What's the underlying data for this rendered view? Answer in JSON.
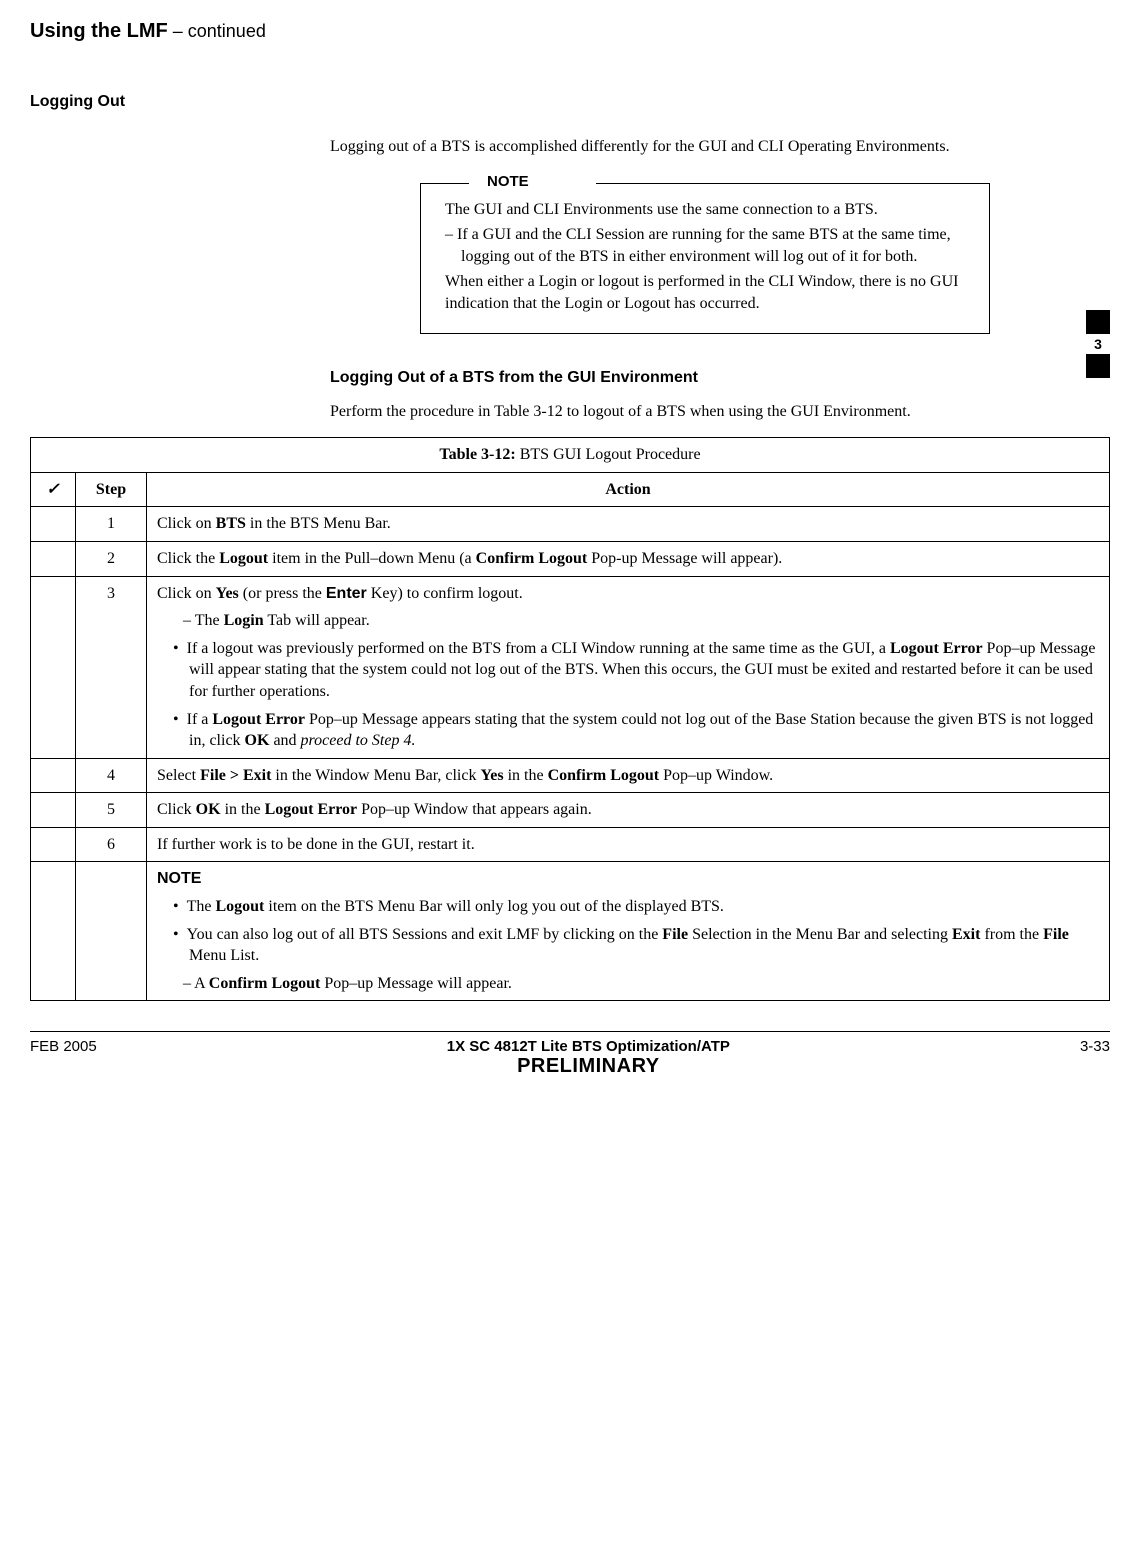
{
  "header": {
    "title": "Using the LMF",
    "continued": " – continued"
  },
  "section1": {
    "label": "Logging Out",
    "para1": "Logging out of a BTS is accomplished differently for the GUI and CLI Operating Environments.",
    "note_label": "NOTE",
    "note_p1": "The GUI and CLI Environments use the same connection to a BTS.",
    "note_bullet_prefix": "–  ",
    "note_bullet": "If a GUI and the CLI Session are running for the same BTS at the same time, logging out of the BTS in either environment will log out of it for both.",
    "note_p2": "When either a Login or logout is performed in the CLI Window, there is no GUI indication that the Login or Logout has occurred."
  },
  "section2": {
    "heading": "Logging Out of a BTS from the GUI Environment",
    "para": "Perform the procedure in Table 3-12 to logout of a BTS when using the GUI Environment."
  },
  "table": {
    "title_prefix": "Table 3-12:",
    "title_rest": " BTS GUI Logout Procedure",
    "hdr_check": "✓",
    "hdr_step": "Step",
    "hdr_action": "Action",
    "rows": {
      "r1": {
        "step": "1",
        "a": "Click on ",
        "b": "BTS",
        "c": " in the BTS Menu Bar."
      },
      "r2": {
        "step": "2",
        "a": "Click the ",
        "b1": "Logout",
        "c": " item in the Pull–down Menu (a ",
        "b2": "Confirm Logout",
        "d": " Pop-up Message will appear)."
      },
      "r3": {
        "step": "3",
        "a": "Click on ",
        "b1": "Yes",
        "c": " (or press the ",
        "sb": "Enter",
        "d": " Key) to confirm logout.",
        "sub_prefix": "–  The ",
        "sub_b": "Login",
        "sub_c": " Tab will appear.",
        "bul1_a": "If a logout was previously performed on the BTS from a CLI Window running at the same time as the GUI, a ",
        "bul1_b": "Logout Error",
        "bul1_c": " Pop–up Message will appear stating that the system could not log out of the BTS. When this occurs, the GUI must be exited and restarted before it can be used for further operations.",
        "bul2_a": "If a ",
        "bul2_b": "Logout Error",
        "bul2_c": " Pop–up Message appears stating that the system could not log out of the Base Station because the given BTS is not logged in, click ",
        "bul2_d": "OK",
        "bul2_e": " and ",
        "bul2_i": "proceed to Step 4."
      },
      "r4": {
        "step": "4",
        "a": "Select ",
        "b1": "File > Exit",
        "c": " in the Window Menu Bar, click ",
        "b2": "Yes",
        "d": " in the ",
        "b3": "Confirm Logout",
        "e": " Pop–up Window."
      },
      "r5": {
        "step": "5",
        "a": "Click ",
        "b1": "OK",
        "c": " in the ",
        "b2": "Logout Error",
        "d": " Pop–up Window that appears again."
      },
      "r6": {
        "step": "6",
        "a": "If further work is to be done in the GUI, restart it."
      },
      "rnote": {
        "label": "NOTE",
        "b1_a": "The ",
        "b1_b": "Logout",
        "b1_c": " item on the BTS Menu Bar will only log you out of the displayed BTS.",
        "b2_a": "You can also log out of all BTS Sessions and exit LMF by clicking on the ",
        "b2_b": "File",
        "b2_c": " Selection in the Menu Bar and selecting ",
        "b2_d": "Exit",
        "b2_e": " from the ",
        "b2_f": "File",
        "b2_g": " Menu List.",
        "sub_prefix": "–  A ",
        "sub_b": "Confirm Logout",
        "sub_c": " Pop–up Message will appear."
      }
    }
  },
  "side_tab": {
    "num": "3"
  },
  "footer": {
    "left": "FEB 2005",
    "mid_title": "1X SC 4812T Lite BTS Optimization/ATP",
    "prelim": "PRELIMINARY",
    "right": "3-33"
  }
}
